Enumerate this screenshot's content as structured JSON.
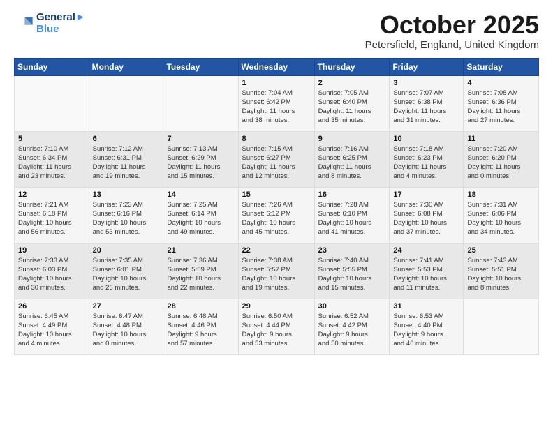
{
  "logo": {
    "line1": "General",
    "line2": "Blue"
  },
  "title": "October 2025",
  "location": "Petersfield, England, United Kingdom",
  "weekdays": [
    "Sunday",
    "Monday",
    "Tuesday",
    "Wednesday",
    "Thursday",
    "Friday",
    "Saturday"
  ],
  "weeks": [
    [
      {
        "day": "",
        "info": ""
      },
      {
        "day": "",
        "info": ""
      },
      {
        "day": "",
        "info": ""
      },
      {
        "day": "1",
        "info": "Sunrise: 7:04 AM\nSunset: 6:42 PM\nDaylight: 11 hours\nand 38 minutes."
      },
      {
        "day": "2",
        "info": "Sunrise: 7:05 AM\nSunset: 6:40 PM\nDaylight: 11 hours\nand 35 minutes."
      },
      {
        "day": "3",
        "info": "Sunrise: 7:07 AM\nSunset: 6:38 PM\nDaylight: 11 hours\nand 31 minutes."
      },
      {
        "day": "4",
        "info": "Sunrise: 7:08 AM\nSunset: 6:36 PM\nDaylight: 11 hours\nand 27 minutes."
      }
    ],
    [
      {
        "day": "5",
        "info": "Sunrise: 7:10 AM\nSunset: 6:34 PM\nDaylight: 11 hours\nand 23 minutes."
      },
      {
        "day": "6",
        "info": "Sunrise: 7:12 AM\nSunset: 6:31 PM\nDaylight: 11 hours\nand 19 minutes."
      },
      {
        "day": "7",
        "info": "Sunrise: 7:13 AM\nSunset: 6:29 PM\nDaylight: 11 hours\nand 15 minutes."
      },
      {
        "day": "8",
        "info": "Sunrise: 7:15 AM\nSunset: 6:27 PM\nDaylight: 11 hours\nand 12 minutes."
      },
      {
        "day": "9",
        "info": "Sunrise: 7:16 AM\nSunset: 6:25 PM\nDaylight: 11 hours\nand 8 minutes."
      },
      {
        "day": "10",
        "info": "Sunrise: 7:18 AM\nSunset: 6:23 PM\nDaylight: 11 hours\nand 4 minutes."
      },
      {
        "day": "11",
        "info": "Sunrise: 7:20 AM\nSunset: 6:20 PM\nDaylight: 11 hours\nand 0 minutes."
      }
    ],
    [
      {
        "day": "12",
        "info": "Sunrise: 7:21 AM\nSunset: 6:18 PM\nDaylight: 10 hours\nand 56 minutes."
      },
      {
        "day": "13",
        "info": "Sunrise: 7:23 AM\nSunset: 6:16 PM\nDaylight: 10 hours\nand 53 minutes."
      },
      {
        "day": "14",
        "info": "Sunrise: 7:25 AM\nSunset: 6:14 PM\nDaylight: 10 hours\nand 49 minutes."
      },
      {
        "day": "15",
        "info": "Sunrise: 7:26 AM\nSunset: 6:12 PM\nDaylight: 10 hours\nand 45 minutes."
      },
      {
        "day": "16",
        "info": "Sunrise: 7:28 AM\nSunset: 6:10 PM\nDaylight: 10 hours\nand 41 minutes."
      },
      {
        "day": "17",
        "info": "Sunrise: 7:30 AM\nSunset: 6:08 PM\nDaylight: 10 hours\nand 37 minutes."
      },
      {
        "day": "18",
        "info": "Sunrise: 7:31 AM\nSunset: 6:06 PM\nDaylight: 10 hours\nand 34 minutes."
      }
    ],
    [
      {
        "day": "19",
        "info": "Sunrise: 7:33 AM\nSunset: 6:03 PM\nDaylight: 10 hours\nand 30 minutes."
      },
      {
        "day": "20",
        "info": "Sunrise: 7:35 AM\nSunset: 6:01 PM\nDaylight: 10 hours\nand 26 minutes."
      },
      {
        "day": "21",
        "info": "Sunrise: 7:36 AM\nSunset: 5:59 PM\nDaylight: 10 hours\nand 22 minutes."
      },
      {
        "day": "22",
        "info": "Sunrise: 7:38 AM\nSunset: 5:57 PM\nDaylight: 10 hours\nand 19 minutes."
      },
      {
        "day": "23",
        "info": "Sunrise: 7:40 AM\nSunset: 5:55 PM\nDaylight: 10 hours\nand 15 minutes."
      },
      {
        "day": "24",
        "info": "Sunrise: 7:41 AM\nSunset: 5:53 PM\nDaylight: 10 hours\nand 11 minutes."
      },
      {
        "day": "25",
        "info": "Sunrise: 7:43 AM\nSunset: 5:51 PM\nDaylight: 10 hours\nand 8 minutes."
      }
    ],
    [
      {
        "day": "26",
        "info": "Sunrise: 6:45 AM\nSunset: 4:49 PM\nDaylight: 10 hours\nand 4 minutes."
      },
      {
        "day": "27",
        "info": "Sunrise: 6:47 AM\nSunset: 4:48 PM\nDaylight: 10 hours\nand 0 minutes."
      },
      {
        "day": "28",
        "info": "Sunrise: 6:48 AM\nSunset: 4:46 PM\nDaylight: 9 hours\nand 57 minutes."
      },
      {
        "day": "29",
        "info": "Sunrise: 6:50 AM\nSunset: 4:44 PM\nDaylight: 9 hours\nand 53 minutes."
      },
      {
        "day": "30",
        "info": "Sunrise: 6:52 AM\nSunset: 4:42 PM\nDaylight: 9 hours\nand 50 minutes."
      },
      {
        "day": "31",
        "info": "Sunrise: 6:53 AM\nSunset: 4:40 PM\nDaylight: 9 hours\nand 46 minutes."
      },
      {
        "day": "",
        "info": ""
      }
    ]
  ]
}
